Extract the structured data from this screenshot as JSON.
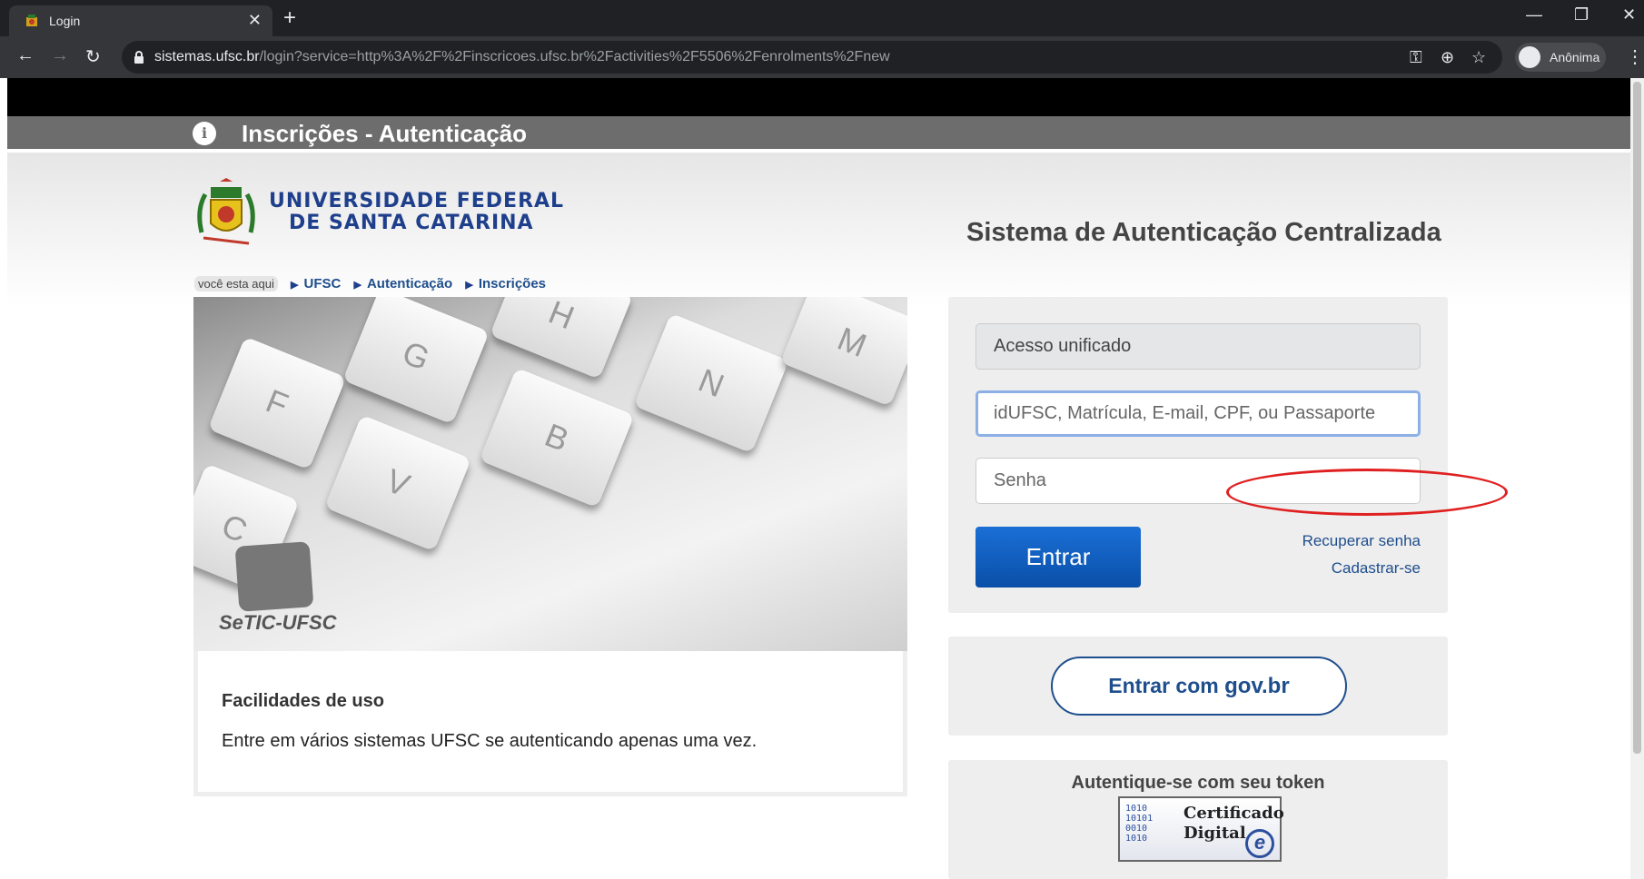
{
  "browser": {
    "tab_title": "Login",
    "url_host": "sistemas.ufsc.br",
    "url_path": "/login?service=http%3A%2F%2Finscricoes.ufsc.br%2Factivities%2F5506%2Fenrolments%2Fnew",
    "profile_label": "Anônima"
  },
  "header": {
    "title": "Inscrições - Autenticação"
  },
  "university": {
    "line1": "UNIVERSIDADE FEDERAL",
    "line2": "DE SANTA CATARINA"
  },
  "breadcrumb": {
    "here": "você esta aqui",
    "items": [
      "UFSC",
      "Autenticação",
      "Inscrições"
    ]
  },
  "banner": {
    "keys": [
      "F",
      "G",
      "H",
      "V",
      "B",
      "N",
      "M",
      "C"
    ],
    "brand": "SeTIC-UFSC"
  },
  "info": {
    "heading": "Facilidades de uso",
    "text": "Entre em vários sistemas UFSC se autenticando apenas uma vez."
  },
  "login": {
    "system_title": "Sistema de Autenticação Centralizada",
    "unified_label": "Acesso unificado",
    "user_placeholder": "idUFSC, Matrícula, E-mail, CPF, ou Passaporte",
    "password_placeholder": "Senha",
    "submit_label": "Entrar",
    "recover_link": "Recuperar senha",
    "register_link": "Cadastrar-se"
  },
  "govbr": {
    "prefix": "Entrar com",
    "brand": "gov.br"
  },
  "token": {
    "title": "Autentique-se com seu token",
    "cert_line1": "Certificado",
    "cert_line2": "Digital"
  },
  "colors": {
    "header_gray": "#6d6d6d",
    "link_blue": "#1e4e8c",
    "button_blue": "#0a4fa8",
    "annotation_red": "#e02020"
  }
}
